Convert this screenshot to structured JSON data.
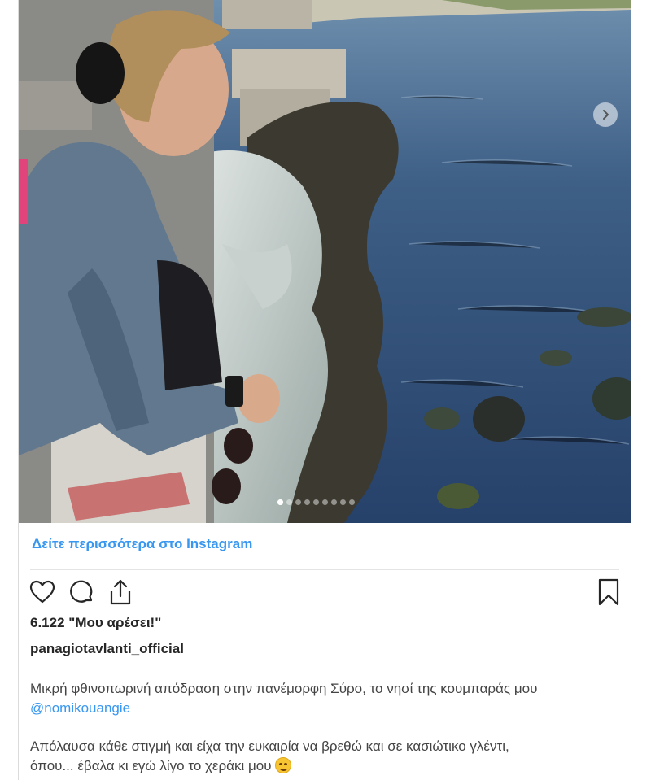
{
  "post": {
    "see_more": "Δείτε περισσότερα στο Instagram",
    "likes": "6.122 \"Μου αρέσει!\"",
    "username": "panagiotavlanti_official",
    "caption_line1": "Μικρή φθινοπωρινή απόδραση στην πανέμορφη Σύρο, το νησί της κουμπαράς μου",
    "mention": "@nomikouangie",
    "caption_line2": "Απόλαυσα κάθε στιγμή και είχα την ευκαιρία να βρεθώ και σε κασιώτικο γλέντι,",
    "caption_line3": "όπου... έβαλα κι εγώ λίγο το χεράκι μου",
    "carousel_count": 9,
    "carousel_active": 1
  },
  "icons": [
    "heart-icon",
    "comment-icon",
    "share-icon",
    "bookmark-icon",
    "chevron-right-icon",
    "smiling-emoji"
  ],
  "colors": {
    "link": "#3897f0",
    "text": "#262626"
  }
}
